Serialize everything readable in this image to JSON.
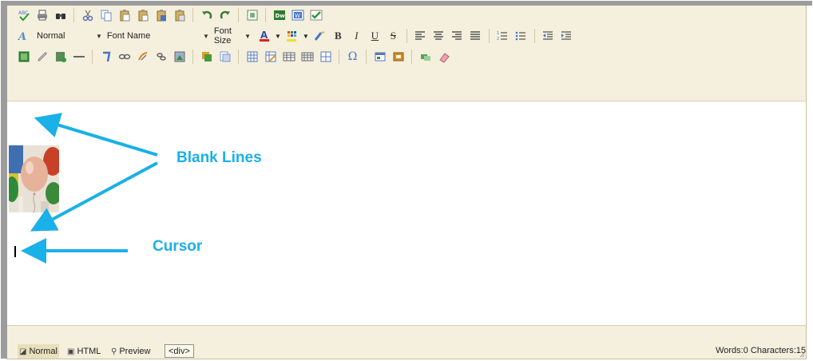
{
  "toolbar": {
    "paragraph_style": "Normal",
    "font_name": "Font Name",
    "font_size": "Font Size",
    "row1_icons": [
      "spellcheck-icon",
      "print-icon",
      "find-icon",
      "cut-icon",
      "copy-icon",
      "paste-icon",
      "paste-text-icon",
      "paste-word-icon",
      "undo-icon",
      "redo-icon",
      "select-all-icon",
      "dreamweaver-icon",
      "word-icon",
      "checkmark-icon"
    ],
    "row3_icons": [
      "insert-image-icon",
      "insert-link-icon",
      "insert-media-icon",
      "horizontal-rule-icon",
      "insert-anchor-icon",
      "link-icon",
      "unlink-icon",
      "hyperlink-icon",
      "image-map-icon",
      "insert-form-icon",
      "insert-template-icon",
      "insert-table-icon",
      "table-properties-icon",
      "insert-row-icon",
      "insert-column-icon",
      "cell-properties-icon",
      "special-character-icon",
      "insert-box-icon",
      "insert-box-alt-icon",
      "insert-layer-icon",
      "eraser-icon"
    ]
  },
  "annotations": {
    "blank_lines": "Blank Lines",
    "cursor": "Cursor"
  },
  "statusbar": {
    "normal": "Normal",
    "html": "HTML",
    "preview": "Preview",
    "tag": "<div>",
    "count": "Words:0 Characters:15"
  },
  "colors": {
    "accent": "#1ab0e8",
    "toolbar_bg": "#f4f0dd"
  }
}
